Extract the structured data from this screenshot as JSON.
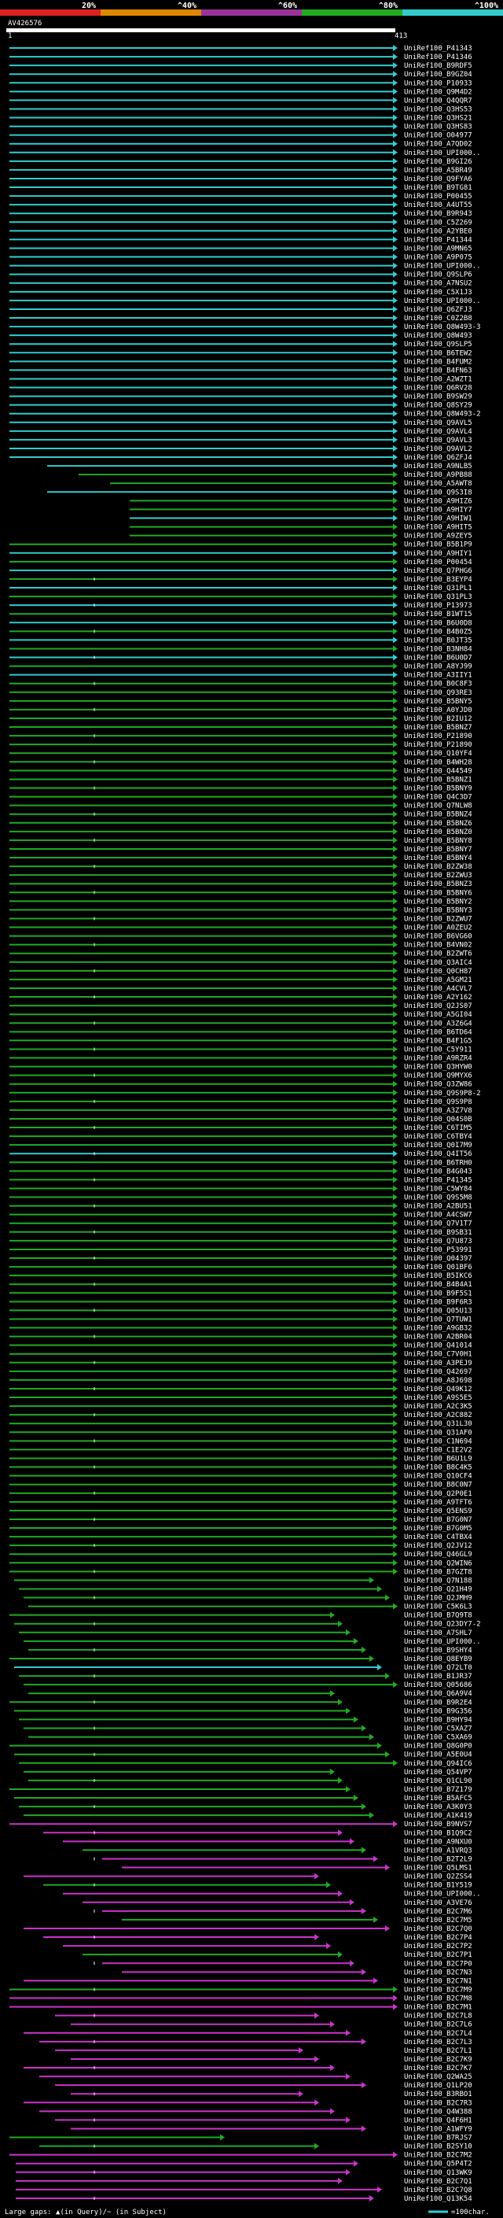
{
  "header": {
    "query_name": "AV426576",
    "scale_labels": [
      "20%",
      "^40%",
      "^60%",
      "^80%",
      "^100%"
    ],
    "query_start": "1",
    "query_end": "413",
    "colors": {
      "cyan": "#33cccc",
      "green": "#22aa22",
      "magenta": "#cc33cc",
      "red": "#dd2222",
      "orange": "#dd8800"
    }
  },
  "chart_data": {
    "type": "alignment",
    "title": "AV426576",
    "query_range": [
      1,
      413
    ],
    "identity_legend": [
      {
        "label": "20%",
        "color": "#dd2222"
      },
      {
        "label": "^40%",
        "color": "#dd8800"
      },
      {
        "label": "^60%",
        "color": "#993399"
      },
      {
        "label": "^80%",
        "color": "#22aa22"
      },
      {
        "label": "^100%",
        "color": "#33cccc"
      }
    ],
    "hits": [
      "UniRef100_P41343",
      "UniRef100_P41346",
      "UniRef100_B9RDF5",
      "UniRef100_B9GZ04",
      "UniRef100_P10933",
      "UniRef100_Q9M4D2",
      "UniRef100_Q4QQR7",
      "UniRef100_Q3HS53",
      "UniRef100_Q3HS21",
      "UniRef100_Q3HS83",
      "UniRef100_O04977",
      "UniRef100_A7QD02",
      "UniRef100_UPI000..",
      "UniRef100_B9GI26",
      "UniRef100_A5BR49",
      "UniRef100_Q9FYA6",
      "UniRef100_B9TG81",
      "UniRef100_P00455",
      "UniRef100_A4UT55",
      "UniRef100_B9R943",
      "UniRef100_C5Z269",
      "UniRef100_A2YBE0",
      "UniRef100_P41344",
      "UniRef100_A9MN65",
      "UniRef100_A9P075",
      "UniRef100_UPI000..",
      "UniRef100_Q9SLP6",
      "UniRef100_A7NSU2",
      "UniRef100_C5X1J3",
      "UniRef100_UPI000..",
      "UniRef100_Q6ZFJ3",
      "UniRef100_C0Z2B8",
      "UniRef100_Q8W493-3",
      "UniRef100_Q8W493",
      "UniRef100_Q9SLP5",
      "UniRef100_B6TEW2",
      "UniRef100_B4FUM2",
      "UniRef100_B4FN63",
      "UniRef100_A2WZT1",
      "UniRef100_Q6RV28",
      "UniRef100_B9SW29",
      "UniRef100_Q8SY29",
      "UniRef100_Q8W493-2",
      "UniRef100_Q9AVL5",
      "UniRef100_Q9AVL4",
      "UniRef100_Q9AVL3",
      "UniRef100_Q9AVL2",
      "UniRef100_Q6ZFJ4",
      "UniRef100_A9NLB5",
      "UniRef100_A9PB88",
      "UniRef100_A5AWT8",
      "UniRef100_Q9S3I8",
      "UniRef100_A9HIZ6",
      "UniRef100_A9HIY7",
      "UniRef100_A9HIW1",
      "UniRef100_A9HIT5",
      "UniRef100_A9ZEY5",
      "UniRef100_B5B1P9",
      "UniRef100_A9HIY1",
      "UniRef100_P00454",
      "UniRef100_Q7PHG6",
      "UniRef100_B3EYP4",
      "UniRef100_Q31PL1",
      "UniRef100_Q31PL3",
      "UniRef100_P13973",
      "UniRef100_B1WT15",
      "UniRef100_B6U0D8",
      "UniRef100_B4B0Z5",
      "UniRef100_B0JT35",
      "UniRef100_B3NH84",
      "UniRef100_B6U0D7",
      "UniRef100_A8YJ99",
      "UniRef100_A3IIY1",
      "UniRef100_B0C8F3",
      "UniRef100_Q93RE3",
      "UniRef100_B5BNY5",
      "UniRef100_A0YJD0",
      "UniRef100_B2IU12",
      "UniRef100_B5BNZ7",
      "UniRef100_P21890",
      "UniRef100_P21890",
      "UniRef100_Q10YF4",
      "UniRef100_B4WH28",
      "UniRef100_Q44549",
      "UniRef100_B5BNZ1",
      "UniRef100_B5BNY9",
      "UniRef100_Q4C3D7",
      "UniRef100_Q7NLW8",
      "UniRef100_B5BNZ4",
      "UniRef100_B5BNZ6",
      "UniRef100_B5BNZ0",
      "UniRef100_B5BNY8",
      "UniRef100_B5BNY7",
      "UniRef100_B5BNY4",
      "UniRef100_B2ZW38",
      "UniRef100_B2ZWU3",
      "UniRef100_B5BNZ3",
      "UniRef100_B5BNY6",
      "UniRef100_B5BNY2",
      "UniRef100_B5BNY3",
      "UniRef100_B2ZWU7",
      "UniRef100_A0ZEU2",
      "UniRef100_B6VG60",
      "UniRef100_B4VN02",
      "UniRef100_B2ZWT6",
      "UniRef100_Q3AIC4",
      "UniRef100_Q0CH87",
      "UniRef100_A5GM21",
      "UniRef100_A4CVL7",
      "UniRef100_A2Y162",
      "UniRef100_Q2JS07",
      "UniRef100_A5GI04",
      "UniRef100_A3Z6G4",
      "UniRef100_B6TD64",
      "UniRef100_B4F1G5",
      "UniRef100_C5Y911",
      "UniRef100_A9RZR4",
      "UniRef100_Q3HYW0",
      "UniRef100_Q9MYX6",
      "UniRef100_Q3ZW86",
      "UniRef100_Q9S9P8-2",
      "UniRef100_Q9S9P8",
      "UniRef100_A3Z7V8",
      "UniRef100_Q04S0B",
      "UniRef100_C6TIM5",
      "UniRef100_C6TBY4",
      "UniRef100_Q0I7M9",
      "UniRef100_Q4IT56",
      "UniRef100_B6TRH0",
      "UniRef100_B4G043",
      "UniRef100_P41345",
      "UniRef100_C5WY84",
      "UniRef100_Q9S5M8",
      "UniRef100_A2BU51",
      "UniRef100_A4CSW7",
      "UniRef100_Q7V1T7",
      "UniRef100_B9SB31",
      "UniRef100_Q7U873",
      "UniRef100_P53991",
      "UniRef100_Q04397",
      "UniRef100_Q01BF6",
      "UniRef100_B5IKC6",
      "UniRef100_B4B4A1",
      "UniRef100_B9F5S1",
      "UniRef100_B9F6R3",
      "UniRef100_Q05U13",
      "UniRef100_Q7TUW1",
      "UniRef100_A9GB32",
      "UniRef100_A2BR04",
      "UniRef100_Q41014",
      "UniRef100_C7V0H1",
      "UniRef100_A3PEJ9",
      "UniRef100_Q42697",
      "UniRef100_A8J698",
      "UniRef100_Q49K12",
      "UniRef100_A9S5E5",
      "UniRef100_A2C3K5",
      "UniRef100_A2C882",
      "UniRef100_Q31L30",
      "UniRef100_Q31AF0",
      "UniRef100_C1N694",
      "UniRef100_C1E2V2",
      "UniRef100_B6U1L9",
      "UniRef100_B8C4K5",
      "UniRef100_Q10CF4",
      "UniRef100_B8C0N7",
      "UniRef100_Q2P0E1",
      "UniRef100_A9TFT6",
      "UniRef100_Q5ENS9",
      "UniRef100_B7G0N7",
      "UniRef100_B7G0M5",
      "UniRef100_C4TBX4",
      "UniRef100_Q2JV12",
      "UniRef100_Q46GL9",
      "UniRef100_Q2WIN6",
      "UniRef100_B7GZT8",
      "UniRef100_Q7N188",
      "UniRef100_Q21H49",
      "UniRef100_Q2JMH9",
      "UniRef100_C5K6L3",
      "UniRef100_B7Q9T8",
      "UniRef100_Q23DY7-2",
      "UniRef100_A7SHL7",
      "UniRef100_UPI000..",
      "UniRef100_B9SHY4",
      "UniRef100_Q8EYB9",
      "UniRef100_Q72LT0",
      "UniRef100_B1JR37",
      "UniRef100_Q05686",
      "UniRef100_Q6A9V4",
      "UniRef100_B9R2E4",
      "UniRef100_B9G356",
      "UniRef100_B9HY94",
      "UniRef100_C5XAZ7",
      "UniRef100_C5XA69",
      "UniRef100_Q8G0P0",
      "UniRef100_A5E0U4",
      "UniRef100_Q94IC6",
      "UniRef100_Q54VP7",
      "UniRef100_Q1CL90",
      "UniRef100_B7Z179",
      "UniRef100_B5AFC5",
      "UniRef100_A3K0Y3",
      "UniRef100_A1K419",
      "UniRef100_B9NVS7",
      "UniRef100_B1Q9C2",
      "UniRef100_A9NXU0",
      "UniRef100_A1VRQ3",
      "UniRef100_B2T2L9",
      "UniRef100_Q5LMS1",
      "UniRef100_Q2ZSS4",
      "UniRef100_B1Y519",
      "UniRef100_UPI000..",
      "UniRef100_A3VE76",
      "UniRef100_B2C7M6",
      "UniRef100_B2C7M5",
      "UniRef100_B2C7Q0",
      "UniRef100_B2C7P4",
      "UniRef100_B2C7P2",
      "UniRef100_B2C7P1",
      "UniRef100_B2C7P0",
      "UniRef100_B2C7N3",
      "UniRef100_B2C7N1",
      "UniRef100_B2C7M9",
      "UniRef100_B2C7M8",
      "UniRef100_B2C7M1",
      "UniRef100_B2C7L8",
      "UniRef100_B2C7L6",
      "UniRef100_B2C7L4",
      "UniRef100_B2C7L3",
      "UniRef100_B2C7L1",
      "UniRef100_B2C7K9",
      "UniRef100_B2C7K7",
      "UniRef100_Q2WA25",
      "UniRef100_Q1LP20",
      "UniRef100_B3RBO1",
      "UniRef100_B2C7R3",
      "UniRef100_Q4W388",
      "UniRef100_Q4F6H1",
      "UniRef100_A1WFY9",
      "UniRef100_B7RJS7",
      "UniRef100_B2SY10",
      "UniRef100_B2C7M2",
      "UniRef100_Q5P4T2",
      "UniRef100_Q13WK9",
      "UniRef100_B2C7Q1",
      "UniRef100_B2C7Q8",
      "UniRef100_Q13K54"
    ],
    "legend_footer": {
      "gap_text": "Large gaps: ▲(in Query)/~ (in Subject)",
      "scale_text": "=100char."
    }
  }
}
